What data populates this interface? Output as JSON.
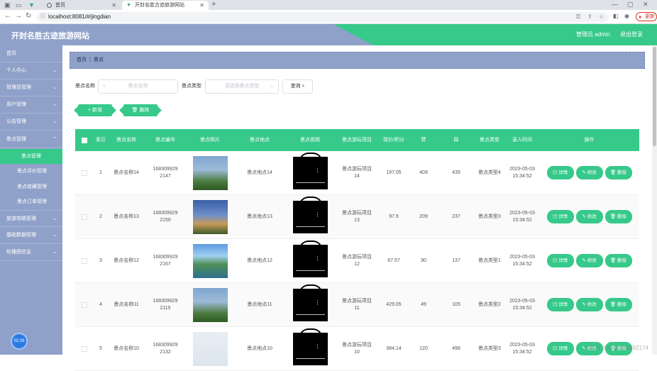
{
  "browser": {
    "tabs": [
      {
        "title": "首页"
      },
      {
        "title": "开封名胜古迹旅游网站"
      }
    ],
    "url": "localhost:8081/#/jingdian",
    "update_label": "更新"
  },
  "header": {
    "site_title": "开封名胜古迹旅游网站",
    "admin_text": "管理员 admin",
    "logout_label": "退出登录"
  },
  "sidebar": {
    "items": [
      {
        "label": "首页"
      },
      {
        "label": "个人中心"
      },
      {
        "label": "管理员管理"
      },
      {
        "label": "用户管理"
      },
      {
        "label": "公告管理"
      },
      {
        "label": "景点管理"
      },
      {
        "label": "旅游攻略管理"
      },
      {
        "label": "基础数据管理"
      },
      {
        "label": "轮播图信息"
      }
    ],
    "subitems": [
      {
        "label": "景点管理"
      },
      {
        "label": "景点评价管理"
      },
      {
        "label": "景点收藏管理"
      },
      {
        "label": "景点订单管理"
      }
    ],
    "clock": "02:29"
  },
  "breadcrumb": {
    "home": "首页",
    "current": "景点"
  },
  "search": {
    "name_label": "景点名称",
    "name_placeholder": "景点名称",
    "type_label": "景点类型",
    "type_placeholder": "请选择景点类型",
    "query_label": "查询"
  },
  "actions": {
    "add_label": "新增",
    "delete_label": "删除"
  },
  "table": {
    "headers": [
      "索引",
      "景点名称",
      "景点编号",
      "景点照片",
      "景点地点",
      "景点视频",
      "景点游玩项目",
      "现价/积分",
      "赞",
      "踩",
      "景点类型",
      "录入时间",
      "操作"
    ],
    "rows": [
      {
        "index": "1",
        "name": "景点名称14",
        "code": "1683099292147",
        "location": "景点地点14",
        "project": "景点游玩项目14",
        "price": "197.05",
        "zan": "409",
        "cai": "435",
        "type": "景点类型4",
        "time": "2023-05-03 15:34:52"
      },
      {
        "index": "2",
        "name": "景点名称13",
        "code": "1683099292150",
        "location": "景点地点13",
        "project": "景点游玩项目13",
        "price": "97.9",
        "zan": "209",
        "cai": "237",
        "type": "景点类型3",
        "time": "2023-05-03 15:34:52"
      },
      {
        "index": "3",
        "name": "景点名称12",
        "code": "1683099292167",
        "location": "景点地点12",
        "project": "景点游玩项目12",
        "price": "67.57",
        "zan": "90",
        "cai": "137",
        "type": "景点类型1",
        "time": "2023-05-03 15:34:52"
      },
      {
        "index": "4",
        "name": "景点名称11",
        "code": "1683099292115",
        "location": "景点地点11",
        "project": "景点游玩项目11",
        "price": "429.05",
        "zan": "49",
        "cai": "105",
        "type": "景点类型2",
        "time": "2023-05-03 15:34:52"
      },
      {
        "index": "5",
        "name": "景点名称10",
        "code": "1683099292132",
        "location": "景点地点10",
        "project": "景点游玩项目10",
        "price": "384.14",
        "zan": "120",
        "cai": "498",
        "type": "景点类型3",
        "time": "2023-05-03 15:34:52"
      }
    ],
    "op_labels": {
      "detail": "详情",
      "edit": "修改",
      "delete": "删除"
    }
  },
  "watermark": "CSDN @QQ1039692174",
  "colors": {
    "accent": "#36c98a",
    "sidebar": "#8fa1c9"
  }
}
